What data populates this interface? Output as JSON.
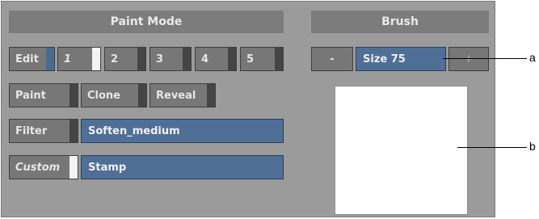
{
  "paint_mode": {
    "header": "Paint Mode",
    "edit_label": "Edit",
    "slots": [
      "1",
      "2",
      "3",
      "4",
      "5"
    ],
    "mode_buttons": [
      "Paint",
      "Clone",
      "Reveal"
    ],
    "filter_label": "Filter",
    "filter_value": "Soften_medium",
    "custom_label": "Custom",
    "custom_value": "Stamp"
  },
  "brush": {
    "header": "Brush",
    "minus_label": "-",
    "size_value": "Size 75",
    "plus_label": "+"
  },
  "callouts": {
    "a": "a",
    "b": "b"
  }
}
